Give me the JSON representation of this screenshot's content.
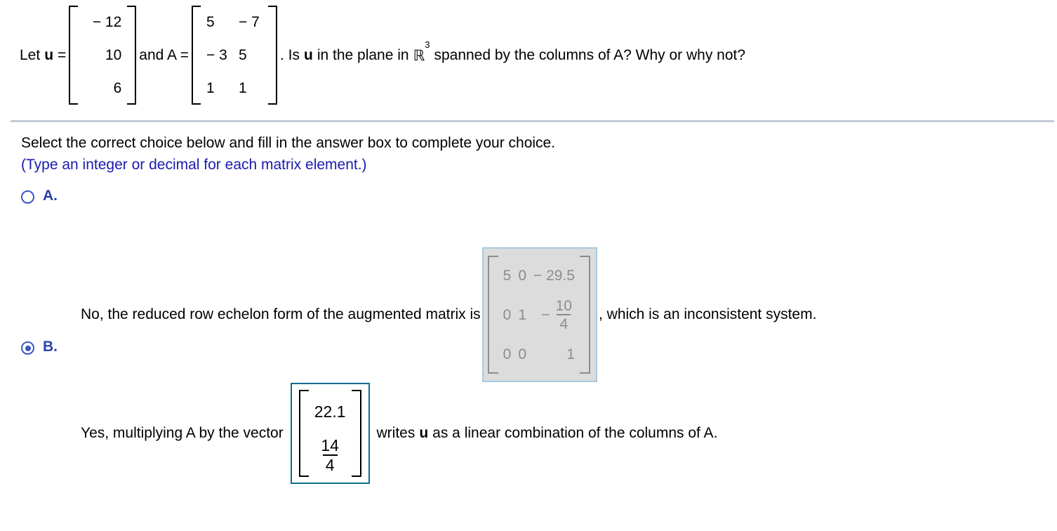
{
  "question": {
    "prefix": "Let",
    "u_symbol": "u",
    "equals": "=",
    "vector_u": [
      "− 12",
      "10",
      "6"
    ],
    "and_text": "and A =",
    "matrix_a": [
      [
        "5",
        "− 7"
      ],
      [
        "− 3",
        "5"
      ],
      [
        "1",
        "1"
      ]
    ],
    "tail_before_u": ". Is",
    "tail_u_symbol": "u",
    "tail_mid": "in the plane in",
    "field_symbol": "ℝ",
    "field_exponent": "3",
    "tail_end": "spanned by the columns of A? Why or why not?"
  },
  "instructions": {
    "line1": "Select the correct choice below and fill in the answer box to complete your choice.",
    "line2": "(Type an integer or decimal for each matrix element.)"
  },
  "choices": [
    {
      "id": "A",
      "letter": "A.",
      "selected": false,
      "text_before": "No, the reduced row echelon form of the augmented matrix is",
      "text_after": ", which is an inconsistent system.",
      "answer_matrix": {
        "rows": [
          [
            "5",
            "0",
            "− 29.5"
          ],
          [
            "0",
            "1",
            "frac:−:10:4"
          ],
          [
            "0",
            "0",
            "1"
          ]
        ]
      }
    },
    {
      "id": "B",
      "letter": "B.",
      "selected": true,
      "text_before": "Yes, multiplying A by the vector",
      "text_after_u_symbol": "u",
      "text_after_pre": "writes",
      "text_after_post": "as a linear combination of the columns of A.",
      "answer_vector": {
        "entry1": "22.1",
        "entry2_num": "14",
        "entry2_den": "4"
      }
    }
  ],
  "colors": {
    "radio_blue": "#3a57c4",
    "choice_letter_blue": "#2b3fae",
    "instruction_blue": "#1a1ab0",
    "divider_gray": "#c5cad8",
    "disabled_box_bg": "#dcdcdc",
    "disabled_box_border": "#a7cadd",
    "disabled_box_text": "#8c8c8c",
    "active_box_border": "#0c6d8e"
  }
}
